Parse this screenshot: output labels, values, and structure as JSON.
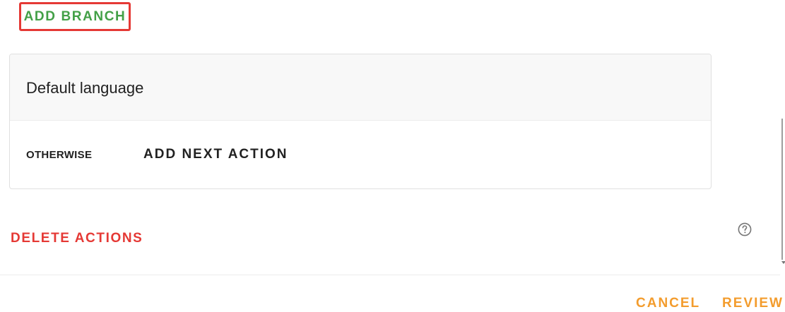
{
  "toolbar": {
    "add_branch_label": "ADD BRANCH"
  },
  "branch_card": {
    "title": "Default language",
    "otherwise_label": "OTHERWISE",
    "add_next_action_label": "ADD NEXT ACTION"
  },
  "actions": {
    "delete_label": "DELETE ACTIONS"
  },
  "help": {
    "icon": "help-circle-icon"
  },
  "footer": {
    "cancel_label": "CANCEL",
    "review_label": "REVIEW"
  },
  "colors": {
    "add_branch": "#43a047",
    "highlight_border": "#e53935",
    "delete": "#e53935",
    "footer_buttons": "#f39c2d"
  }
}
